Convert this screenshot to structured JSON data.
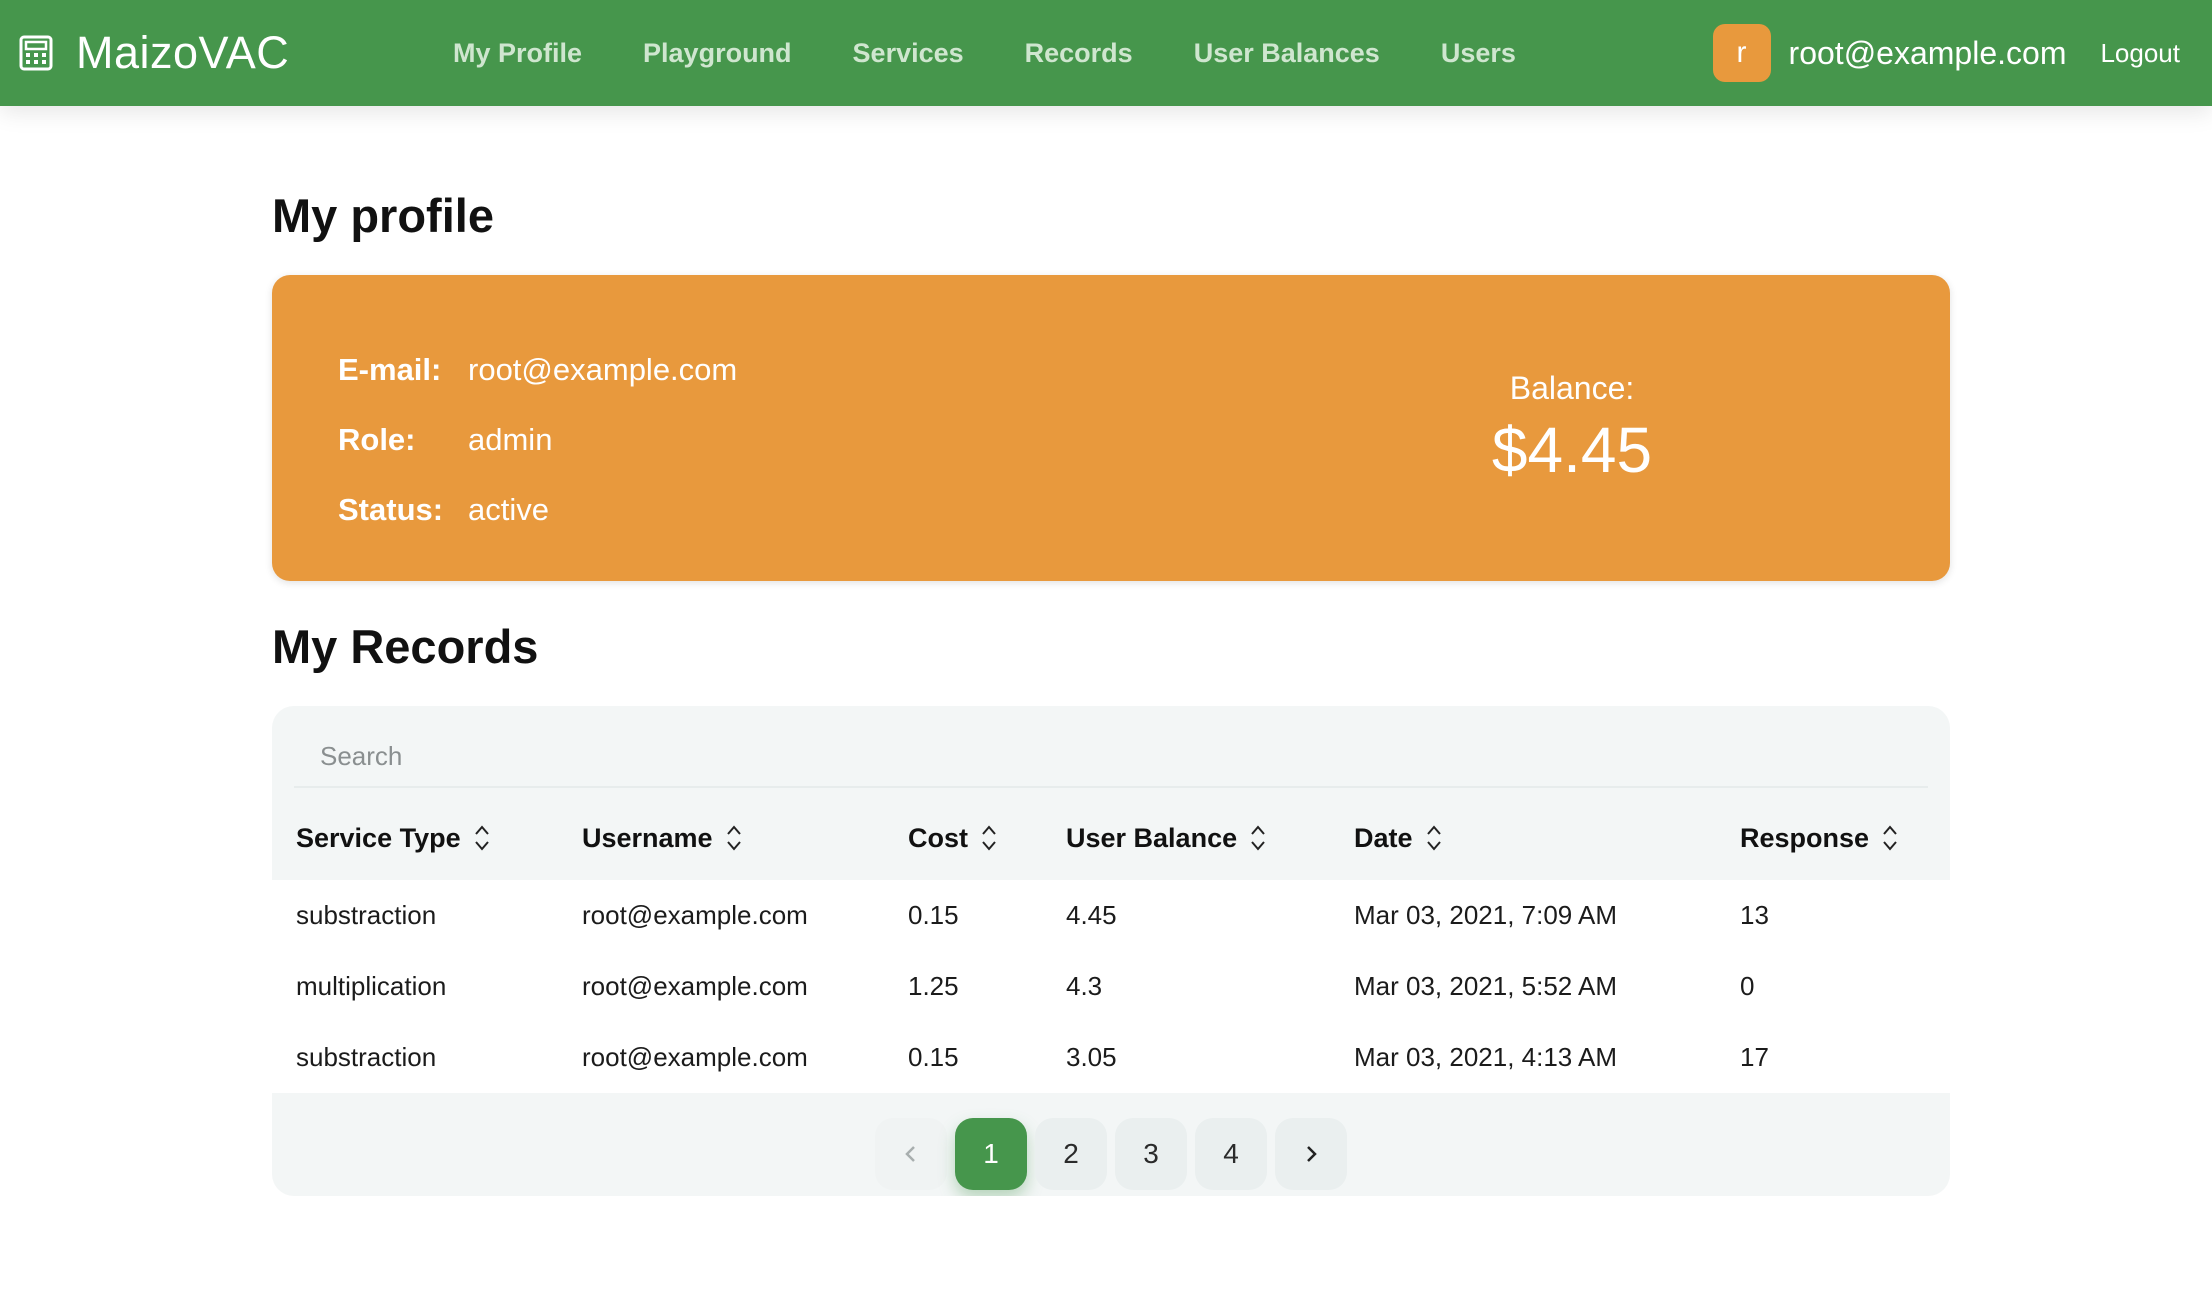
{
  "nav": {
    "brand": "MaizoVAC",
    "brand_icon": "calculator-icon",
    "links": [
      "My Profile",
      "Playground",
      "Services",
      "Records",
      "User Balances",
      "Users"
    ],
    "avatar_letter": "r",
    "user_email": "root@example.com",
    "logout": "Logout",
    "colors": {
      "bar": "#46964c",
      "avatar": "#e8993d"
    }
  },
  "profile": {
    "title": "My profile",
    "email_label": "E-mail:",
    "email": "root@example.com",
    "role_label": "Role:",
    "role": "admin",
    "status_label": "Status:",
    "status": "active",
    "balance_label": "Balance:",
    "balance": "$4.45",
    "card_color": "#e8993d"
  },
  "records": {
    "title": "My Records",
    "search_placeholder": "Search",
    "columns": [
      "Service Type",
      "Username",
      "Cost",
      "User Balance",
      "Date",
      "Response"
    ],
    "rows": [
      [
        "substraction",
        "root@example.com",
        "0.15",
        "4.45",
        "Mar 03, 2021, 7:09 AM",
        "13"
      ],
      [
        "multiplication",
        "root@example.com",
        "1.25",
        "4.3",
        "Mar 03, 2021, 5:52 AM",
        "0"
      ],
      [
        "substraction",
        "root@example.com",
        "0.15",
        "3.05",
        "Mar 03, 2021, 4:13 AM",
        "17"
      ]
    ],
    "pagination": {
      "pages": [
        "1",
        "2",
        "3",
        "4"
      ],
      "current": "1",
      "prev_icon": "chevron-left-icon",
      "next_icon": "chevron-right-icon"
    }
  }
}
